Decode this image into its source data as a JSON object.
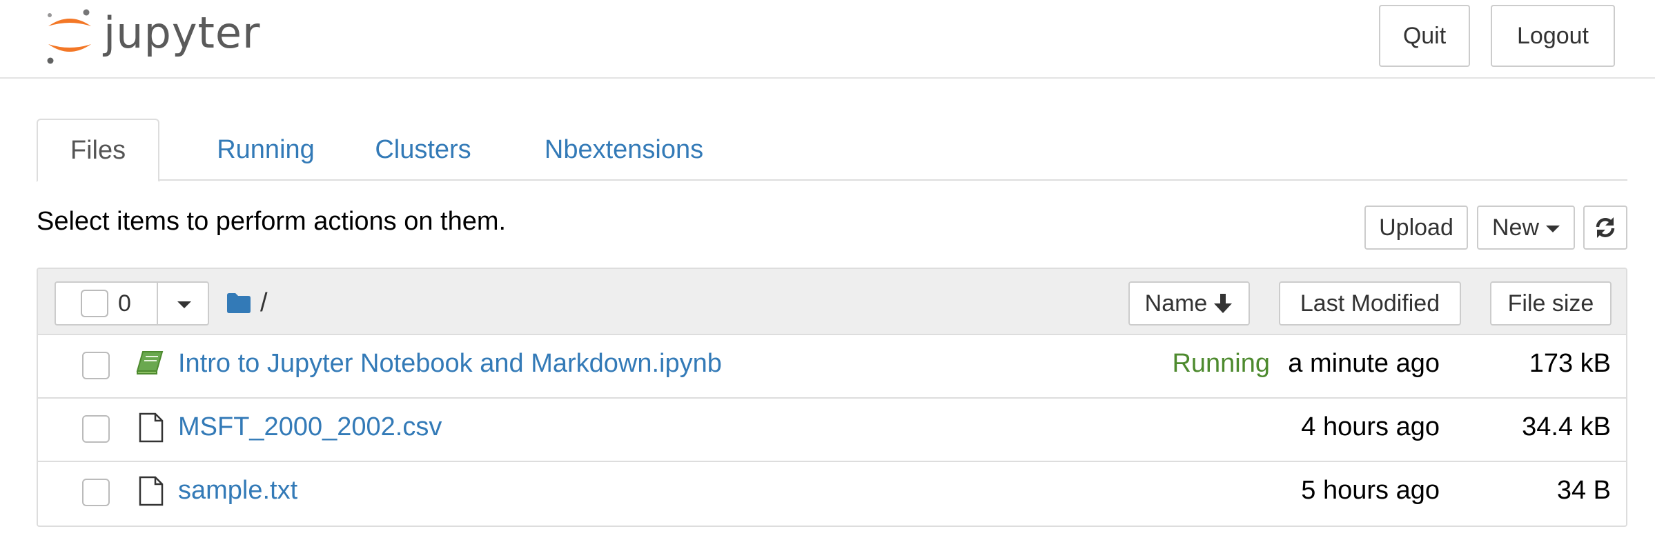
{
  "header": {
    "logo_text": "jupyter",
    "quit_label": "Quit",
    "logout_label": "Logout"
  },
  "tabs": [
    {
      "label": "Files",
      "active": true
    },
    {
      "label": "Running",
      "active": false
    },
    {
      "label": "Clusters",
      "active": false
    },
    {
      "label": "Nbextensions",
      "active": false
    }
  ],
  "toolbar": {
    "instructions": "Select items to perform actions on them.",
    "upload_label": "Upload",
    "new_label": "New",
    "refresh_icon": "refresh-icon"
  },
  "list_header": {
    "selected_count": "0",
    "breadcrumb_icon": "folder-icon",
    "breadcrumb_path": "/",
    "sort_name_label": "Name",
    "sort_name_icon": "arrow-down-icon",
    "sort_modified_label": "Last Modified",
    "sort_size_label": "File size"
  },
  "files": [
    {
      "name": "Intro to Jupyter Notebook and Markdown.ipynb",
      "icon": "notebook-icon",
      "status": "Running",
      "modified": "a minute ago",
      "size": "173 kB"
    },
    {
      "name": "MSFT_2000_2002.csv",
      "icon": "file-icon",
      "status": "",
      "modified": "4 hours ago",
      "size": "34.4 kB"
    },
    {
      "name": "sample.txt",
      "icon": "file-icon",
      "status": "",
      "modified": "5 hours ago",
      "size": "34 B"
    }
  ],
  "colors": {
    "link": "#337ab7",
    "running": "#4d8a2e",
    "logo_orange": "#f37726",
    "border": "#dddddd"
  }
}
